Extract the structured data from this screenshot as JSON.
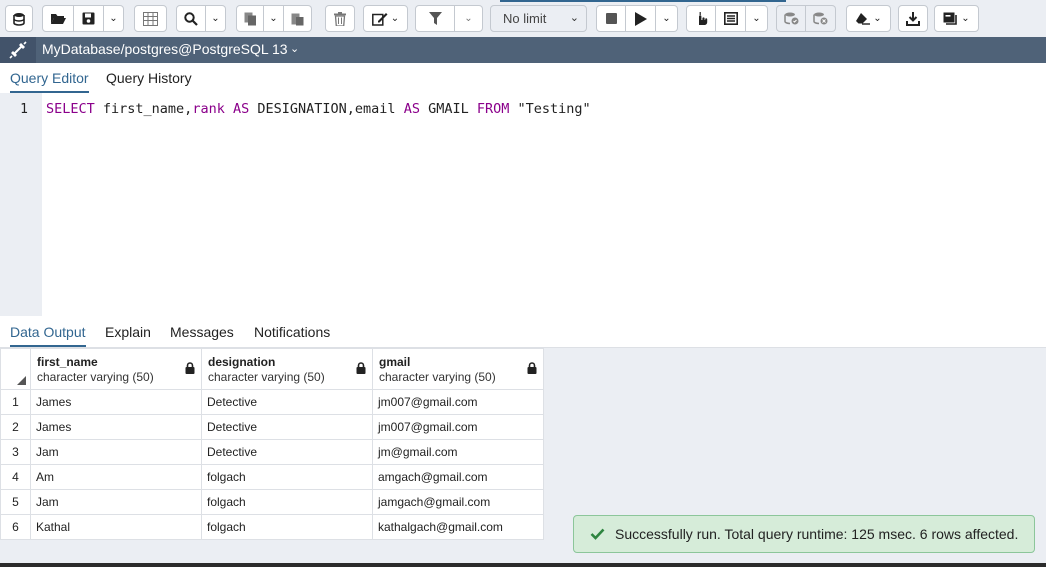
{
  "toolbar": {
    "limit_selected": "No limit"
  },
  "connection": {
    "label": "MyDatabase/postgres@PostgreSQL 13"
  },
  "editor_tabs": [
    "Query Editor",
    "Query History"
  ],
  "editor": {
    "line_number": "1",
    "tokens": [
      {
        "text": "SELECT",
        "kw": true
      },
      {
        "text": " first_name,",
        "kw": false
      },
      {
        "text": "rank",
        "kw": true
      },
      {
        "text": " ",
        "kw": false
      },
      {
        "text": "AS",
        "kw": true
      },
      {
        "text": " DESIGNATION,email ",
        "kw": false
      },
      {
        "text": "AS",
        "kw": true
      },
      {
        "text": " GMAIL ",
        "kw": false
      },
      {
        "text": "FROM",
        "kw": true
      },
      {
        "text": " \"Testing\"",
        "kw": false
      }
    ]
  },
  "output_tabs": [
    "Data Output",
    "Explain",
    "Messages",
    "Notifications"
  ],
  "grid": {
    "columns": [
      {
        "name": "first_name",
        "type": "character varying (50)"
      },
      {
        "name": "designation",
        "type": "character varying (50)"
      },
      {
        "name": "gmail",
        "type": "character varying (50)"
      }
    ],
    "rows": [
      {
        "n": "1",
        "cells": [
          "James",
          "Detective",
          "jm007@gmail.com"
        ]
      },
      {
        "n": "2",
        "cells": [
          "James",
          "Detective",
          "jm007@gmail.com"
        ]
      },
      {
        "n": "3",
        "cells": [
          "Jam",
          "Detective",
          "jm@gmail.com"
        ]
      },
      {
        "n": "4",
        "cells": [
          "Am",
          "folgach",
          "amgach@gmail.com"
        ]
      },
      {
        "n": "5",
        "cells": [
          "Jam",
          "folgach",
          "jamgach@gmail.com"
        ]
      },
      {
        "n": "6",
        "cells": [
          "Kathal",
          "folgach",
          "kathalgach@gmail.com"
        ]
      }
    ]
  },
  "toast": {
    "message": "Successfully run. Total query runtime: 125 msec. 6 rows affected."
  },
  "colors": {
    "accent": "#326690",
    "keyword": "#8b008b",
    "toolbar_bg": "#ebeef3",
    "connection_bar": "#4f6278",
    "toast_bg": "#d6ecd9",
    "toast_check": "#2e8540"
  },
  "icons": [
    "database-icon",
    "folder-open-icon",
    "save-icon",
    "grid-view-icon",
    "search-icon",
    "copy-icon",
    "paste-icon",
    "delete-icon",
    "edit-icon",
    "filter-icon",
    "stop-icon",
    "execute-icon",
    "explain-icon",
    "explain-analyze-icon",
    "commit-icon",
    "rollback-icon",
    "clear-icon",
    "download-icon",
    "macros-icon",
    "connection-status-icon",
    "lock-icon",
    "check-icon"
  ]
}
